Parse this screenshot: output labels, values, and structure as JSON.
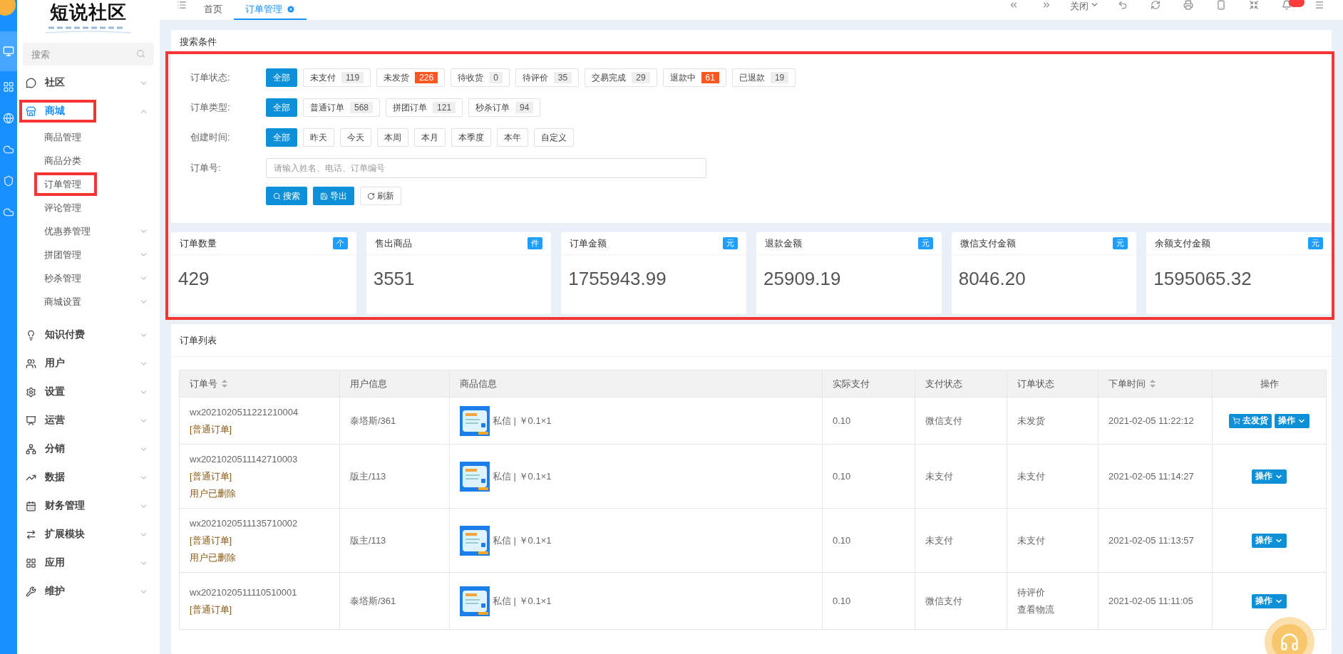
{
  "sidebar": {
    "logo": "短说社区",
    "search": {
      "placeholder": "搜索"
    },
    "items": [
      {
        "label": "社区",
        "selected": false,
        "expanded": false
      },
      {
        "label": "商城",
        "selected": true,
        "expanded": true,
        "children": [
          {
            "label": "商品管理",
            "expandable": false
          },
          {
            "label": "商品分类",
            "expandable": false
          },
          {
            "label": "订单管理",
            "expandable": false
          },
          {
            "label": "评论管理",
            "expandable": false
          },
          {
            "label": "优惠券管理",
            "expandable": true
          },
          {
            "label": "拼团管理",
            "expandable": true
          },
          {
            "label": "秒杀管理",
            "expandable": true
          },
          {
            "label": "商城设置",
            "expandable": true
          }
        ]
      },
      {
        "label": "知识付费",
        "selected": false,
        "expanded": false
      },
      {
        "label": "用户",
        "selected": false,
        "expanded": false
      },
      {
        "label": "设置",
        "selected": false,
        "expanded": false
      },
      {
        "label": "运营",
        "selected": false,
        "expanded": false
      },
      {
        "label": "分销",
        "selected": false,
        "expanded": false
      },
      {
        "label": "数据",
        "selected": false,
        "expanded": false
      },
      {
        "label": "财务管理",
        "selected": false,
        "expanded": false
      },
      {
        "label": "扩展模块",
        "selected": false,
        "expanded": false
      },
      {
        "label": "应用",
        "selected": false,
        "expanded": false
      },
      {
        "label": "维护",
        "selected": false,
        "expanded": false
      }
    ]
  },
  "tabs": [
    {
      "label": "首页",
      "selected": false
    },
    {
      "label": "订单管理",
      "selected": true
    }
  ],
  "toolbar": {
    "close_menu": "关闭"
  },
  "search_panel": {
    "title": "搜索条件",
    "filters": [
      {
        "label": "订单状态:",
        "options": [
          {
            "label": "全部",
            "selected": true
          },
          {
            "label": "未支付",
            "count": "119",
            "hot": false,
            "selected": false
          },
          {
            "label": "未发货",
            "count": "226",
            "hot": true,
            "selected": false
          },
          {
            "label": "待收货",
            "count": "0",
            "hot": false,
            "selected": false
          },
          {
            "label": "待评价",
            "count": "35",
            "hot": false,
            "selected": false
          },
          {
            "label": "交易完成",
            "count": "29",
            "hot": false,
            "selected": false
          },
          {
            "label": "退款中",
            "count": "61",
            "hot": true,
            "selected": false
          },
          {
            "label": "已退款",
            "count": "19",
            "hot": false,
            "selected": false
          }
        ]
      },
      {
        "label": "订单类型:",
        "options": [
          {
            "label": "全部",
            "selected": true
          },
          {
            "label": "普通订单",
            "count": "568",
            "hot": false,
            "selected": false
          },
          {
            "label": "拼团订单",
            "count": "121",
            "hot": false,
            "selected": false
          },
          {
            "label": "秒杀订单",
            "count": "94",
            "hot": false,
            "selected": false
          }
        ]
      },
      {
        "label": "创建时间:",
        "options": [
          {
            "label": "全部",
            "selected": true
          },
          {
            "label": "昨天",
            "selected": false
          },
          {
            "label": "今天",
            "selected": false
          },
          {
            "label": "本周",
            "selected": false
          },
          {
            "label": "本月",
            "selected": false
          },
          {
            "label": "本季度",
            "selected": false
          },
          {
            "label": "本年",
            "selected": false
          },
          {
            "label": "自定义",
            "selected": false
          }
        ]
      }
    ],
    "order_no": {
      "label": "订单号:",
      "placeholder": "请输入姓名、电话、订单编号"
    },
    "buttons": [
      {
        "label": "搜索",
        "kind": "search"
      },
      {
        "label": "导出",
        "kind": "export"
      },
      {
        "label": "刷新",
        "kind": "refresh"
      }
    ]
  },
  "stats": [
    {
      "label": "订单数量",
      "unit": "个",
      "value": "429"
    },
    {
      "label": "售出商品",
      "unit": "件",
      "value": "3551"
    },
    {
      "label": "订单金额",
      "unit": "元",
      "value": "1755943.99"
    },
    {
      "label": "退款金额",
      "unit": "元",
      "value": "25909.19"
    },
    {
      "label": "微信支付金额",
      "unit": "元",
      "value": "8046.20"
    },
    {
      "label": "余额支付金额",
      "unit": "元",
      "value": "1595065.32"
    }
  ],
  "order_list": {
    "title": "订单列表",
    "columns": [
      {
        "label": "订单号",
        "sortable": true
      },
      {
        "label": "用户信息",
        "sortable": false
      },
      {
        "label": "商品信息",
        "sortable": false
      },
      {
        "label": "实际支付",
        "sortable": false
      },
      {
        "label": "支付状态",
        "sortable": false
      },
      {
        "label": "订单状态",
        "sortable": false
      },
      {
        "label": "下单时间",
        "sortable": true
      },
      {
        "label": "操作",
        "sortable": false
      }
    ],
    "rows": [
      {
        "order_no": "wx2021020511221210004",
        "order_type": "[普通订单]",
        "user": "泰塔斯/361",
        "product": "私信 | ￥0.1×1",
        "paid": "0.10",
        "pay_status": "微信支付",
        "order_status": [
          "未发货"
        ],
        "time": "2021-02-05 11:22:12",
        "actions": [
          {
            "label": "去发货",
            "kind": "ship"
          },
          {
            "label": "操作",
            "kind": "menu"
          }
        ]
      },
      {
        "order_no": "wx2021020511142710003",
        "order_type": "[普通订单]",
        "note": "用户已删除",
        "user": "版主/113",
        "product": "私信 | ￥0.1×1",
        "paid": "0.10",
        "pay_status": "未支付",
        "order_status": [
          "未支付"
        ],
        "time": "2021-02-05 11:14:27",
        "actions": [
          {
            "label": "操作",
            "kind": "menu"
          }
        ]
      },
      {
        "order_no": "wx2021020511135710002",
        "order_type": "[普通订单]",
        "note": "用户已删除",
        "user": "版主/113",
        "product": "私信 | ￥0.1×1",
        "paid": "0.10",
        "pay_status": "未支付",
        "order_status": [
          "未支付"
        ],
        "time": "2021-02-05 11:13:57",
        "actions": [
          {
            "label": "操作",
            "kind": "menu"
          }
        ]
      },
      {
        "order_no": "wx2021020511110510001",
        "order_type": "[普通订单]",
        "user": "泰塔斯/361",
        "product": "私信 | ￥0.1×1",
        "paid": "0.10",
        "pay_status": "微信支付",
        "order_status": [
          "待评价",
          "查看物流"
        ],
        "time": "2021-02-05 11:11:05",
        "actions": [
          {
            "label": "操作",
            "kind": "menu"
          }
        ]
      }
    ]
  }
}
